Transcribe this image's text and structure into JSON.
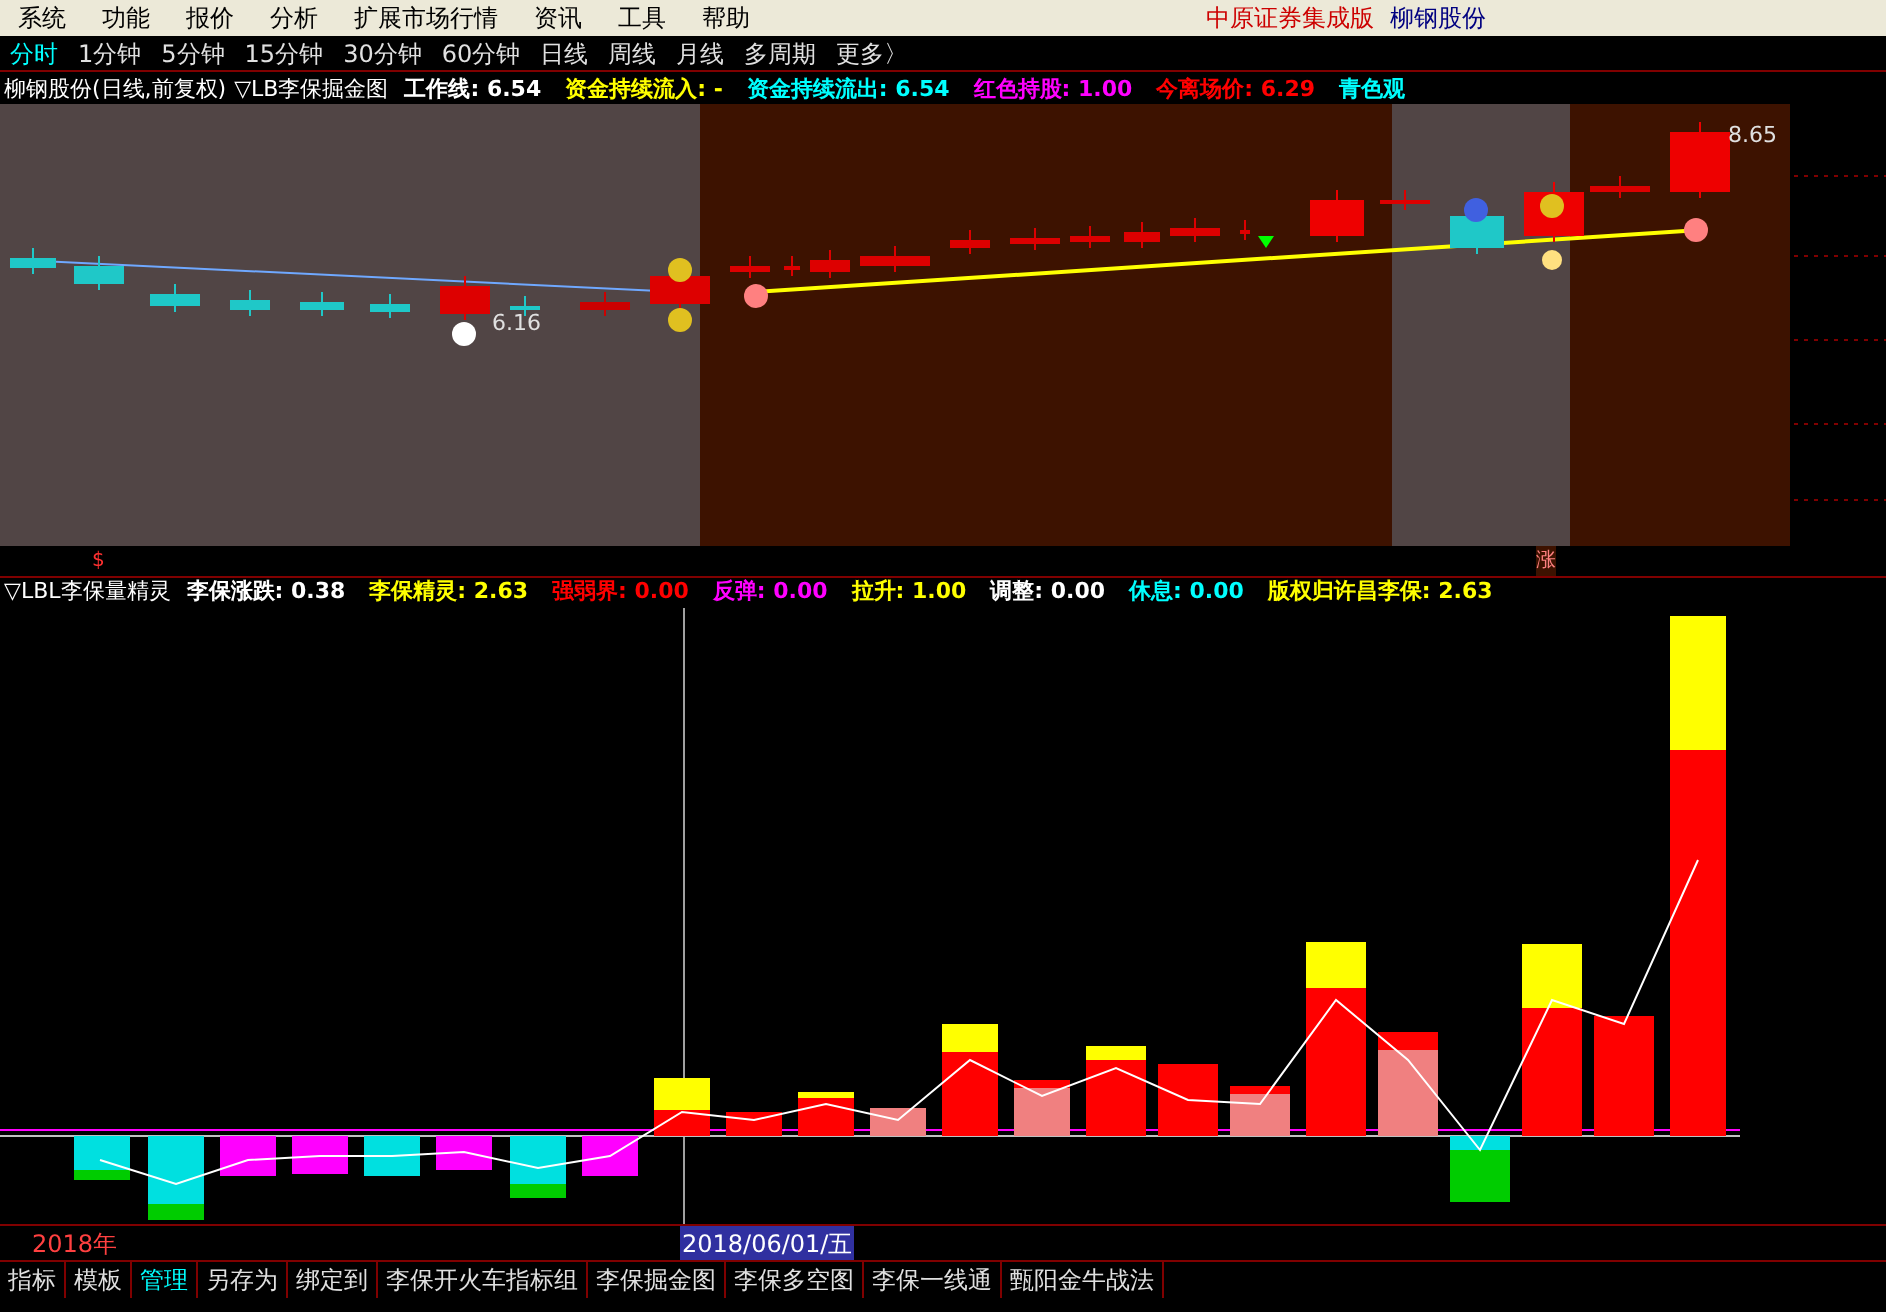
{
  "menu_bar": {
    "items": [
      "系统",
      "功能",
      "报价",
      "分析",
      "扩展市场行情",
      "资讯",
      "工具",
      "帮助"
    ],
    "broker": "中原证券集成版",
    "stock": "柳钢股份"
  },
  "period_tabs": [
    {
      "label": "分时",
      "selected": true
    },
    {
      "label": "1分钟",
      "selected": false
    },
    {
      "label": "5分钟",
      "selected": false
    },
    {
      "label": "15分钟",
      "selected": false
    },
    {
      "label": "30分钟",
      "selected": false
    },
    {
      "label": "60分钟",
      "selected": false
    },
    {
      "label": "日线",
      "selected": false
    },
    {
      "label": "周线",
      "selected": false
    },
    {
      "label": "月线",
      "selected": false
    },
    {
      "label": "多周期",
      "selected": false
    },
    {
      "label": "更多〉",
      "selected": false
    }
  ],
  "main_chart": {
    "title": "柳钢股份(日线,前复权)",
    "indicator": "▽LB李保掘金图",
    "readouts": [
      {
        "label": "工作线: 6.54",
        "color": "#ffffff"
      },
      {
        "label": "资金持续流入: -",
        "color": "#ffff00"
      },
      {
        "label": "资金持续流出: 6.54",
        "color": "#00ffff"
      },
      {
        "label": "红色持股: 1.00",
        "color": "#ff00ff"
      },
      {
        "label": "今离场价: 6.29",
        "color": "#ff0000"
      },
      {
        "label": "青色观",
        "color": "#00ffff"
      }
    ],
    "low_label": "6.16",
    "high_label": "8.65",
    "markers": [
      "$",
      "涨"
    ]
  },
  "sub_chart": {
    "indicator": "▽LBL李保量精灵",
    "readouts": [
      {
        "label": "李保涨跌: 0.38",
        "color": "#ffffff"
      },
      {
        "label": "李保精灵: 2.63",
        "color": "#ffff00"
      },
      {
        "label": "强弱界: 0.00",
        "color": "#ff0000"
      },
      {
        "label": "反弹: 0.00",
        "color": "#ff00ff"
      },
      {
        "label": "拉升: 1.00",
        "color": "#ffff00"
      },
      {
        "label": "调整: 0.00",
        "color": "#ffffff"
      },
      {
        "label": "休息: 0.00",
        "color": "#00ffff"
      },
      {
        "label": "版权归许昌李保: 2.63",
        "color": "#ffff00"
      }
    ]
  },
  "axis": {
    "year": "2018年",
    "cursor_date": "2018/06/01/五"
  },
  "bottom_tabs": [
    {
      "label": "指标",
      "selected": false
    },
    {
      "label": "模板",
      "selected": false
    },
    {
      "label": "管理",
      "selected": true
    },
    {
      "label": "另存为",
      "selected": false
    },
    {
      "label": "绑定到",
      "selected": false
    },
    {
      "label": "李保开火车指标组",
      "selected": false
    },
    {
      "label": "李保掘金图",
      "selected": false
    },
    {
      "label": "李保多空图",
      "selected": false
    },
    {
      "label": "李保一线通",
      "selected": false
    },
    {
      "label": "甄阳金牛战法",
      "selected": false
    }
  ]
}
